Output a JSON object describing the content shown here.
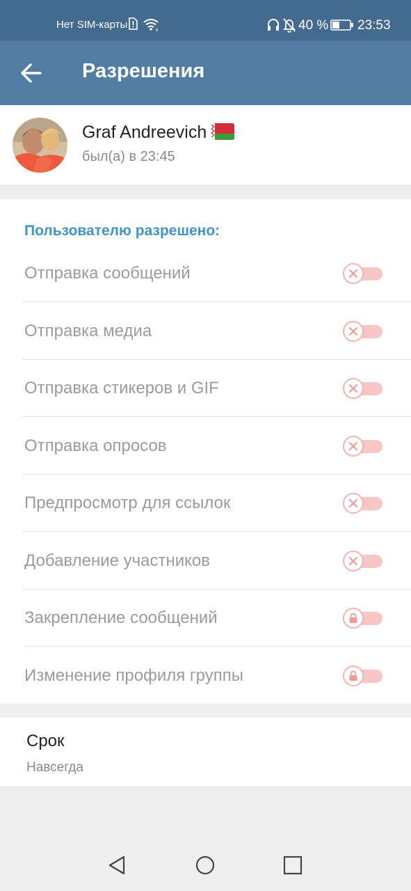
{
  "status_bar": {
    "carrier": "Нет SIM-карты",
    "battery_percent": "40 %",
    "time": "23:53",
    "icons": [
      "sim-alert-icon",
      "wifi-icon",
      "headset-icon",
      "bell-off-icon",
      "battery-icon"
    ]
  },
  "toolbar": {
    "title": "Разрешения",
    "back_icon": "arrow-left-icon"
  },
  "profile": {
    "name": "Graf Andreevich",
    "flag": "belarus-flag",
    "status": "был(а) в 23:45"
  },
  "permissions": {
    "header": "Пользователю разрешено:",
    "items": [
      {
        "label": "Отправка сообщений",
        "enabled": false,
        "icon": "x-icon"
      },
      {
        "label": "Отправка медиа",
        "enabled": false,
        "icon": "x-icon"
      },
      {
        "label": "Отправка стикеров и GIF",
        "enabled": false,
        "icon": "x-icon"
      },
      {
        "label": "Отправка опросов",
        "enabled": false,
        "icon": "x-icon"
      },
      {
        "label": "Предпросмотр для ссылок",
        "enabled": false,
        "icon": "x-icon"
      },
      {
        "label": "Добавление участников",
        "enabled": false,
        "icon": "x-icon"
      },
      {
        "label": "Закрепление сообщений",
        "enabled": false,
        "icon": "lock-icon"
      },
      {
        "label": "Изменение профиля группы",
        "enabled": false,
        "icon": "lock-icon"
      }
    ]
  },
  "term": {
    "title": "Срок",
    "value": "Навсегда"
  },
  "colors": {
    "status_bar": "#446b8d",
    "toolbar": "#527da3",
    "accent": "#3d95c8",
    "toggle_off": "#f8c6c6"
  },
  "nav": [
    "back-triangle-icon",
    "home-circle-icon",
    "recents-square-icon"
  ]
}
